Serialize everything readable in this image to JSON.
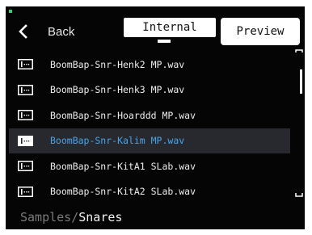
{
  "header": {
    "back_label": "Back",
    "tab_label": "Internal",
    "preview_label": "Preview"
  },
  "files": [
    {
      "name": "BoomBap-Snr-Henk2 MP.wav",
      "selected": false
    },
    {
      "name": "BoomBap-Snr-Henk3 MP.wav",
      "selected": false
    },
    {
      "name": "BoomBap-Snr-Hoarddd MP.wav",
      "selected": false
    },
    {
      "name": "BoomBap-Snr-Kalim MP.wav",
      "selected": true
    },
    {
      "name": "BoomBap-Snr-KitA1 SLab.wav",
      "selected": false
    },
    {
      "name": "BoomBap-Snr-KitA2 SLab.wav",
      "selected": false
    }
  ],
  "breadcrumb": {
    "parent": "Samples",
    "separator": "/",
    "current": "Snares"
  },
  "icons": {
    "file": "audio-file-icon",
    "back": "chevron-left-icon"
  },
  "colors": {
    "background": "#050505",
    "selected_row": "#27292e",
    "selected_text": "#4aa3e8",
    "status_led": "#2bd46a"
  }
}
